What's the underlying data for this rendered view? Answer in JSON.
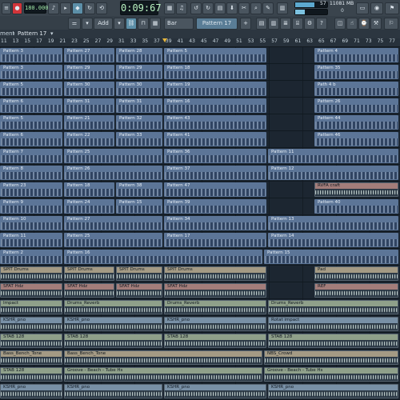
{
  "toolbar": {
    "tempo": "180.000",
    "time_display": "0:09:67",
    "cpu_value": "57",
    "ram_value": "11081 MB",
    "ram_sub": "0",
    "pattern_selector": "Pattern 17",
    "snap_label": "Bar",
    "add_label": "Add",
    "icons": [
      "play-icon",
      "stop-icon",
      "record-icon",
      "metronome-icon",
      "wait-icon",
      "countdown-icon",
      "blend-icon",
      "playlist-icon",
      "piano-roll-icon",
      "channel-rack-icon",
      "mixer-icon",
      "browser-icon",
      "plugin-icon",
      "help-icon"
    ]
  },
  "window": {
    "title_prefix": "ment",
    "title": "Pattern 17"
  },
  "ruler": {
    "ticks": [
      "11",
      "13",
      "15",
      "17",
      "19",
      "21",
      "23",
      "25",
      "27",
      "29",
      "31",
      "33",
      "35",
      "37",
      "39",
      "41",
      "43",
      "45",
      "47",
      "49",
      "51",
      "53",
      "55",
      "57",
      "59",
      "61",
      "63",
      "65",
      "67",
      "69",
      "71",
      "73",
      "75",
      "77"
    ]
  },
  "lanes": [
    {
      "clips": [
        {
          "label": "Pattern 3",
          "kind": "pat"
        },
        {
          "label": "Pattern 27",
          "kind": "pat"
        },
        {
          "label": "Pattern 28",
          "kind": "pat"
        },
        {
          "label": "Pattern 5",
          "kind": "pat"
        },
        {
          "label": "Pattern 4",
          "kind": "pat"
        }
      ]
    },
    {
      "clips": [
        {
          "label": "Pattern 3",
          "kind": "pat"
        },
        {
          "label": "Pattern 29",
          "kind": "pat"
        },
        {
          "label": "Pattern 29",
          "kind": "pat"
        },
        {
          "label": "Pattern 18",
          "kind": "pat"
        },
        {
          "label": "Pattern 35",
          "kind": "pat"
        }
      ]
    },
    {
      "clips": [
        {
          "label": "Pattern 5",
          "kind": "pat"
        },
        {
          "label": "Pattern 30",
          "kind": "pat"
        },
        {
          "label": "Pattern 30",
          "kind": "pat"
        },
        {
          "label": "Pattern 19",
          "kind": "pat"
        },
        {
          "label": "Path 4 b",
          "kind": "pat"
        }
      ]
    },
    {
      "clips": [
        {
          "label": "Pattern 6",
          "kind": "pat"
        },
        {
          "label": "Pattern 31",
          "kind": "pat"
        },
        {
          "label": "Pattern 31",
          "kind": "pat"
        },
        {
          "label": "Pattern 16",
          "kind": "pat"
        },
        {
          "label": "Pattern 26",
          "kind": "pat"
        }
      ]
    },
    {
      "clips": [
        {
          "label": "Pattern 5",
          "kind": "pat"
        },
        {
          "label": "Pattern 21",
          "kind": "pat"
        },
        {
          "label": "Pattern 32",
          "kind": "pat"
        },
        {
          "label": "Pattern 43",
          "kind": "pat"
        },
        {
          "label": "Pattern 44",
          "kind": "pat"
        }
      ]
    },
    {
      "clips": [
        {
          "label": "Pattern 6",
          "kind": "pat"
        },
        {
          "label": "Pattern 22",
          "kind": "pat"
        },
        {
          "label": "Pattern 33",
          "kind": "pat"
        },
        {
          "label": "Pattern 41",
          "kind": "pat"
        },
        {
          "label": "Pattern 46",
          "kind": "pat"
        }
      ]
    },
    {
      "clips": [
        {
          "label": "Pattern 7",
          "kind": "pat"
        },
        {
          "label": "Pattern 25",
          "kind": "pat"
        },
        {
          "label": "Pattern 36",
          "kind": "pat"
        },
        {
          "label": "Pattern 11",
          "kind": "pat"
        }
      ]
    },
    {
      "clips": [
        {
          "label": "Pattern 8",
          "kind": "pat"
        },
        {
          "label": "Pattern 26",
          "kind": "pat"
        },
        {
          "label": "Pattern 37",
          "kind": "pat"
        },
        {
          "label": "Pattern 12",
          "kind": "pat"
        }
      ]
    },
    {
      "clips": [
        {
          "label": "Pattern 23",
          "kind": "pat"
        },
        {
          "label": "Pattern 18",
          "kind": "pat"
        },
        {
          "label": "Pattern 38",
          "kind": "pat"
        },
        {
          "label": "Pattern 47",
          "kind": "pat"
        },
        {
          "label": "RVFA craft",
          "kind": "aud",
          "tone": "red"
        }
      ]
    },
    {
      "clips": [
        {
          "label": "Pattern 9",
          "kind": "pat"
        },
        {
          "label": "Pattern 24",
          "kind": "pat"
        },
        {
          "label": "Pattern 15",
          "kind": "pat"
        },
        {
          "label": "Pattern 39",
          "kind": "pat"
        },
        {
          "label": "Pattern 40",
          "kind": "pat"
        }
      ]
    },
    {
      "clips": [
        {
          "label": "Pattern 10",
          "kind": "pat"
        },
        {
          "label": "Pattern 27",
          "kind": "pat"
        },
        {
          "label": "Pattern 34",
          "kind": "pat"
        },
        {
          "label": "Pattern 13",
          "kind": "pat"
        }
      ]
    },
    {
      "clips": [
        {
          "label": "Pattern 11",
          "kind": "pat"
        },
        {
          "label": "Pattern 25",
          "kind": "pat"
        },
        {
          "label": "Pattern 17",
          "kind": "pat"
        },
        {
          "label": "Pattern 14",
          "kind": "pat"
        }
      ]
    },
    {
      "clips": [
        {
          "label": "Pattern 2",
          "kind": "pat"
        },
        {
          "label": "Pattern 16",
          "kind": "pat"
        },
        {
          "label": "Pattern 15",
          "kind": "pat"
        }
      ]
    },
    {
      "clips": [
        {
          "label": "SPIT Drums",
          "kind": "aud",
          "tone": "tan"
        },
        {
          "label": "SPIT Drums",
          "kind": "aud",
          "tone": "tan"
        },
        {
          "label": "SPIT Drums",
          "kind": "aud",
          "tone": "tan"
        },
        {
          "label": "SPIT Drums",
          "kind": "aud",
          "tone": "tan"
        },
        {
          "label": "Pad",
          "kind": "aud",
          "tone": "tan"
        }
      ]
    },
    {
      "clips": [
        {
          "label": "SFAT Hdz",
          "kind": "aud",
          "tone": "red"
        },
        {
          "label": "SFAT Hdz",
          "kind": "aud",
          "tone": "red"
        },
        {
          "label": "SFAT Hdz",
          "kind": "aud",
          "tone": "red"
        },
        {
          "label": "SFAT Hdz",
          "kind": "aud",
          "tone": "red"
        },
        {
          "label": "REF",
          "kind": "aud",
          "tone": "red"
        }
      ]
    },
    {
      "clips": [
        {
          "label": "Impact",
          "kind": "aud",
          "tone": "green"
        },
        {
          "label": "Drums_Reverb",
          "kind": "aud",
          "tone": "green"
        },
        {
          "label": "Drums_Reverb",
          "kind": "aud",
          "tone": "green"
        },
        {
          "label": "Drums_Reverb",
          "kind": "aud",
          "tone": "green"
        }
      ]
    },
    {
      "clips": [
        {
          "label": "KSHR_pno",
          "kind": "aud",
          "tone": "blue"
        },
        {
          "label": "KSHR_pno",
          "kind": "aud",
          "tone": "blue"
        },
        {
          "label": "KSHR_pno",
          "kind": "aud",
          "tone": "blue"
        },
        {
          "label": "Rotat impact",
          "kind": "aud",
          "tone": "blue"
        }
      ]
    },
    {
      "clips": [
        {
          "label": "STAB 128",
          "kind": "aud",
          "tone": "green"
        },
        {
          "label": "STAB 128",
          "kind": "aud",
          "tone": "green"
        },
        {
          "label": "STAB 128",
          "kind": "aud",
          "tone": "green"
        },
        {
          "label": "STAB 128",
          "kind": "aud",
          "tone": "green"
        }
      ]
    },
    {
      "clips": [
        {
          "label": "Bass_Bench_Tone",
          "kind": "aud",
          "tone": "tan"
        },
        {
          "label": "Bass_Bench_Tone",
          "kind": "aud",
          "tone": "tan"
        },
        {
          "label": "NBS_Crowd",
          "kind": "aud",
          "tone": "tan"
        }
      ]
    },
    {
      "clips": [
        {
          "label": "STAB 128",
          "kind": "aud",
          "tone": "green"
        },
        {
          "label": "Groove - Beach - Tube Hs",
          "kind": "aud",
          "tone": "green"
        },
        {
          "label": "Groove - Beach - Tube Hs",
          "kind": "aud",
          "tone": "green"
        }
      ]
    },
    {
      "clips": [
        {
          "label": "KSHR_pno",
          "kind": "aud",
          "tone": "blue"
        },
        {
          "label": "KSHR_pno",
          "kind": "aud",
          "tone": "blue"
        },
        {
          "label": "KSHR_pno",
          "kind": "aud",
          "tone": "blue"
        },
        {
          "label": "KSHR_pno",
          "kind": "aud",
          "tone": "blue"
        }
      ]
    }
  ]
}
